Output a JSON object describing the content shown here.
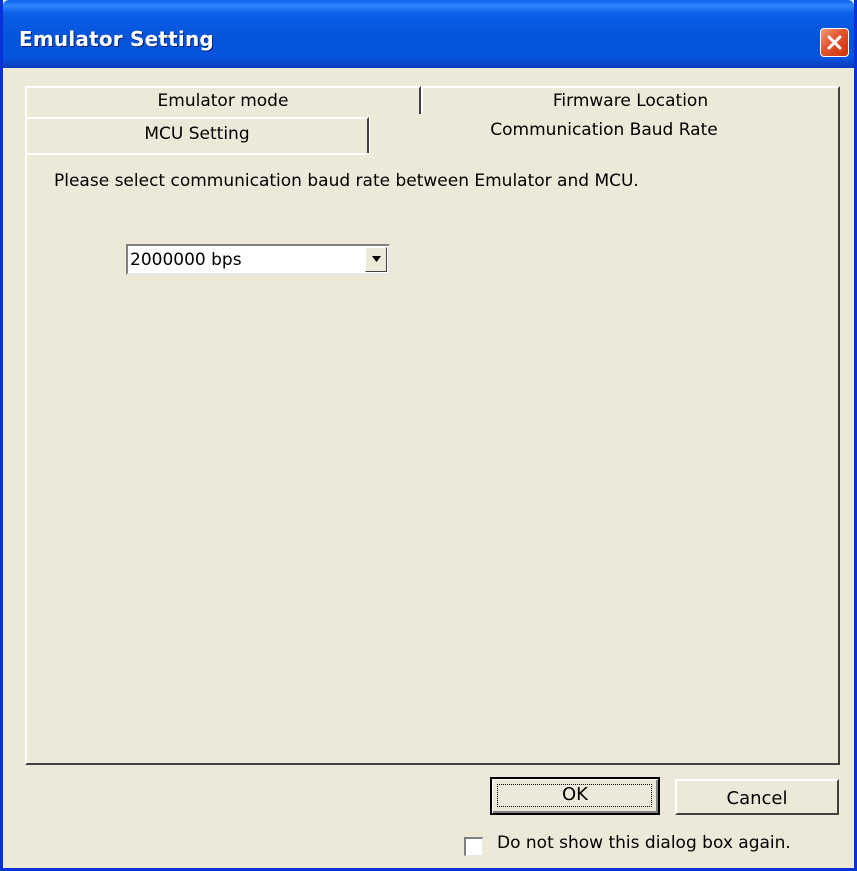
{
  "window": {
    "title": "Emulator Setting",
    "close_icon": "close-x-icon"
  },
  "tabs": {
    "row1": [
      {
        "label": "Emulator mode"
      },
      {
        "label": "Firmware Location"
      }
    ],
    "row2": [
      {
        "label": "MCU Setting"
      },
      {
        "label": "Communication Baud Rate",
        "selected": true
      }
    ]
  },
  "panel": {
    "instruction": "Please select communication baud rate between Emulator and MCU.",
    "baud_select": {
      "value": "2000000 bps",
      "arrow_icon": "dropdown-arrow-icon"
    }
  },
  "buttons": {
    "ok": "OK",
    "cancel": "Cancel"
  },
  "checkbox": {
    "label": "Do not show this dialog box again.",
    "checked": false
  },
  "colors": {
    "titlebar": "#0453d8",
    "close_button": "#e2532d",
    "face": "#ece9d8"
  }
}
